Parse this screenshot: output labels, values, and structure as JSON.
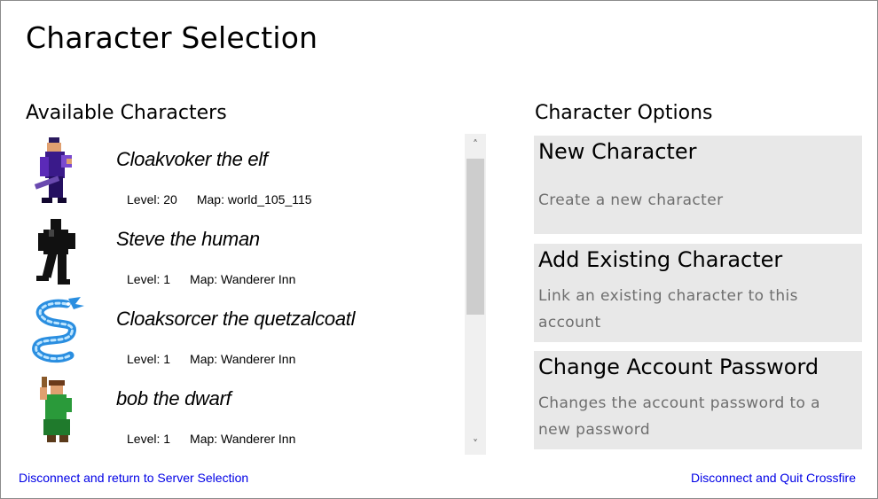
{
  "window": {
    "title": "Character Selection"
  },
  "available": {
    "heading": "Available Characters",
    "characters": [
      {
        "name": "Cloakvoker the elf",
        "level": "Level: 20",
        "map": "Map: world_105_115",
        "icon": "elf-mage-sprite"
      },
      {
        "name": "Steve the human",
        "level": "Level: 1",
        "map": "Map: Wanderer Inn",
        "icon": "human-silhouette-sprite"
      },
      {
        "name": "Cloaksorcer the quetzalcoatl",
        "level": "Level: 1",
        "map": "Map: Wanderer Inn",
        "icon": "quetzalcoatl-serpent-sprite"
      },
      {
        "name": "bob the dwarf",
        "level": "Level: 1",
        "map": "Map: Wanderer Inn",
        "icon": "dwarf-sprite"
      }
    ]
  },
  "scrollbar": {
    "up": "˄",
    "down": "˅"
  },
  "options": {
    "heading": "Character Options",
    "items": [
      {
        "title": "New Character",
        "description": "Create a new character"
      },
      {
        "title": "Add Existing Character",
        "description": "Link an existing character to this account"
      },
      {
        "title": "Change Account Password",
        "description": "Changes the account password to a new password"
      }
    ]
  },
  "footer": {
    "disconnect_return": "Disconnect and return to Server Selection",
    "disconnect_quit": "Disconnect and Quit Crossfire"
  },
  "colors": {
    "link": "#0000e6",
    "card_bg": "#e8e8e8",
    "desc_text": "#6e6e6e"
  }
}
